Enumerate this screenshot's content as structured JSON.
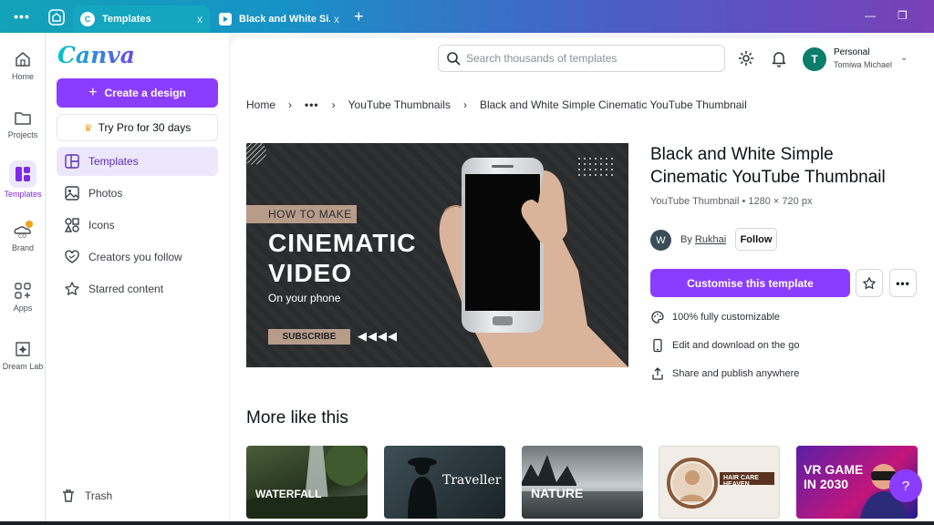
{
  "browser": {
    "tabs": [
      {
        "title": "Templates",
        "close": "x"
      },
      {
        "title": "Black and White Si...",
        "close": "x"
      }
    ],
    "new_tab": "+",
    "minimize": "—",
    "restore": "❐"
  },
  "rail": {
    "items": [
      {
        "label": "Home",
        "icon": "home-icon"
      },
      {
        "label": "Projects",
        "icon": "folder-icon"
      },
      {
        "label": "Templates",
        "icon": "templates-icon"
      },
      {
        "label": "Brand",
        "icon": "brand-icon"
      },
      {
        "label": "Apps",
        "icon": "apps-icon"
      },
      {
        "label": "Dream Lab",
        "icon": "dream-lab-icon"
      }
    ]
  },
  "panel": {
    "logo": "Canva",
    "create_label": "Create a design",
    "pro_label": "Try Pro for 30 days",
    "nav": [
      {
        "label": "Templates"
      },
      {
        "label": "Photos"
      },
      {
        "label": "Icons"
      },
      {
        "label": "Creators you follow"
      },
      {
        "label": "Starred content"
      }
    ],
    "trash_label": "Trash"
  },
  "header": {
    "search_placeholder": "Search thousands of templates",
    "account_type": "Personal",
    "account_user": "Tomiwa Michael",
    "avatar_initial": "T"
  },
  "breadcrumb": {
    "home": "Home",
    "more": "•••",
    "category": "YouTube Thumbnails",
    "current": "Black and White Simple Cinematic YouTube Thumbnail"
  },
  "preview": {
    "how_to": "HOW TO MAKE",
    "line1": "CINEMATIC",
    "line2": "VIDEO",
    "sub": "On your phone",
    "subscribe": "SUBSCRIBE",
    "arrows": "◀◀◀◀"
  },
  "details": {
    "title": "Black and White Simple Cinematic YouTube Thumbnail",
    "meta": "YouTube Thumbnail • 1280 × 720 px",
    "author_initial": "W",
    "by": "By",
    "author": "Rukhai",
    "follow_label": "Follow",
    "customise_label": "Customise this template",
    "features": [
      {
        "label": "100% fully customizable",
        "icon": "palette-icon"
      },
      {
        "label": "Edit and download on the go",
        "icon": "phone-icon"
      },
      {
        "label": "Share and publish anywhere",
        "icon": "share-icon"
      }
    ]
  },
  "more_like_this": {
    "title": "More like this",
    "thumbs": [
      {
        "label": "WATERFALL"
      },
      {
        "label": "Traveller"
      },
      {
        "label": "NATURE"
      },
      {
        "label": "HAIR CARE HEAVEN"
      },
      {
        "label": "VR GAME IN 2030"
      }
    ]
  },
  "help_label": "?"
}
